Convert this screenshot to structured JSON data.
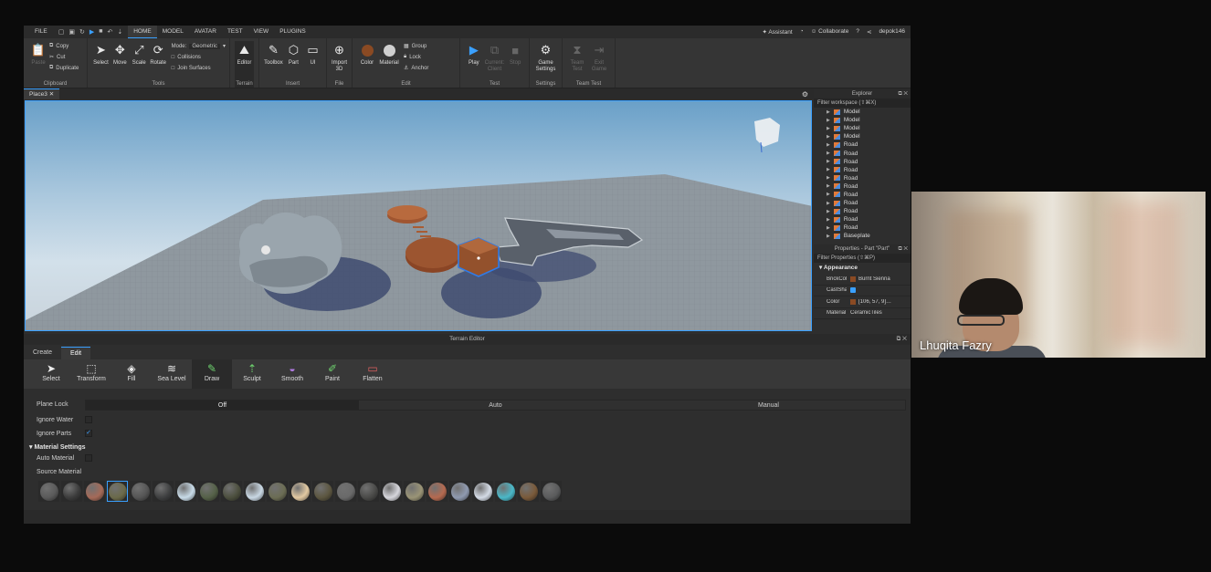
{
  "menubar": {
    "items": [
      "FILE",
      "HOME",
      "MODEL",
      "AVATAR",
      "TEST",
      "VIEW",
      "PLUGINS"
    ],
    "active": "HOME",
    "assistant": "Assistant",
    "collaborate": "Collaborate",
    "user": "depok146"
  },
  "ribbon": {
    "clipboard": {
      "paste": "Paste",
      "copy": "Copy",
      "cut": "Cut",
      "duplicate": "Duplicate",
      "group": "Clipboard"
    },
    "tools": {
      "select": "Select",
      "move": "Move",
      "scale": "Scale",
      "rotate": "Rotate",
      "mode_label": "Mode:",
      "mode_value": "Geometric",
      "collisions": "Collisions",
      "join": "Join Surfaces",
      "group": "Tools"
    },
    "terrain": {
      "editor": "Editor",
      "group": "Terrain"
    },
    "insert": {
      "toolbox": "Toolbox",
      "part": "Part",
      "ui": "UI",
      "group": "Insert"
    },
    "file": {
      "import3d": "Import 3D",
      "group": "File"
    },
    "edit": {
      "color": "Color",
      "material": "Material",
      "group_btn": "Group",
      "lock": "Lock",
      "anchor": "Anchor",
      "group": "Edit"
    },
    "test": {
      "play": "Play",
      "current_client": "Current: Client",
      "stop": "Stop",
      "group": "Test"
    },
    "settings": {
      "game_settings": "Game Settings",
      "group": "Settings"
    },
    "teamtest": {
      "team_test": "Team Test",
      "exit_game": "Exit Game",
      "group": "Team Test"
    }
  },
  "doc_tab": "Place3",
  "explorer": {
    "title": "Explorer",
    "filter": "Filter workspace (⇧⌘X)",
    "items": [
      "Model",
      "Model",
      "Model",
      "Model",
      "Road",
      "Road",
      "Road",
      "Road",
      "Road",
      "Road",
      "Road",
      "Road",
      "Road",
      "Road",
      "Road",
      "Baseplate"
    ]
  },
  "properties": {
    "title": "Properties - Part \"Part\"",
    "filter": "Filter Properties (⇧⌘P)",
    "section": "Appearance",
    "rows": [
      {
        "key": "BrickColor",
        "value": "Burnt Sienna",
        "swatch": "#8a4a23"
      },
      {
        "key": "CastShad…",
        "value": "",
        "check": true
      },
      {
        "key": "Color",
        "value": "[106, 57, 9]…",
        "swatch": "#6a3909"
      },
      {
        "key": "Material",
        "value": "CeramicTiles"
      }
    ]
  },
  "terrain_editor": {
    "title": "Terrain Editor",
    "tabs": [
      "Create",
      "Edit"
    ],
    "active_tab": "Edit",
    "tools": [
      "Select",
      "Transform",
      "Fill",
      "Sea Level",
      "Draw",
      "Sculpt",
      "Smooth",
      "Paint",
      "Flatten"
    ],
    "active_tool": "Draw",
    "plane_lock": {
      "label": "Plane Lock",
      "options": [
        "Off",
        "Auto",
        "Manual"
      ],
      "selected": "Off"
    },
    "ignore_water": "Ignore Water",
    "ignore_parts": "Ignore Parts",
    "material_settings": "Material Settings",
    "auto_material": "Auto Material",
    "source_material": "Source Material",
    "materials": [
      "#5a5a5a",
      "#3c3c3c",
      "#a56a58",
      "#6b6a4a",
      "#555555",
      "#3e3f40",
      "#c8dbe8",
      "#556148",
      "#4c4f3e",
      "#c9d8e4",
      "#6c6d54",
      "#e2c9a2",
      "#5c5640",
      "#6a6a6a",
      "#4a4a48",
      "#d6d6dc",
      "#9a9476",
      "#b56a50",
      "#8f9ab0",
      "#d4dbe6",
      "#4ab8c8",
      "#7a5a3a",
      "#5a5b5c"
    ],
    "selected_material_index": 3
  },
  "webcam": {
    "name": "Lhuqita Fazry"
  }
}
